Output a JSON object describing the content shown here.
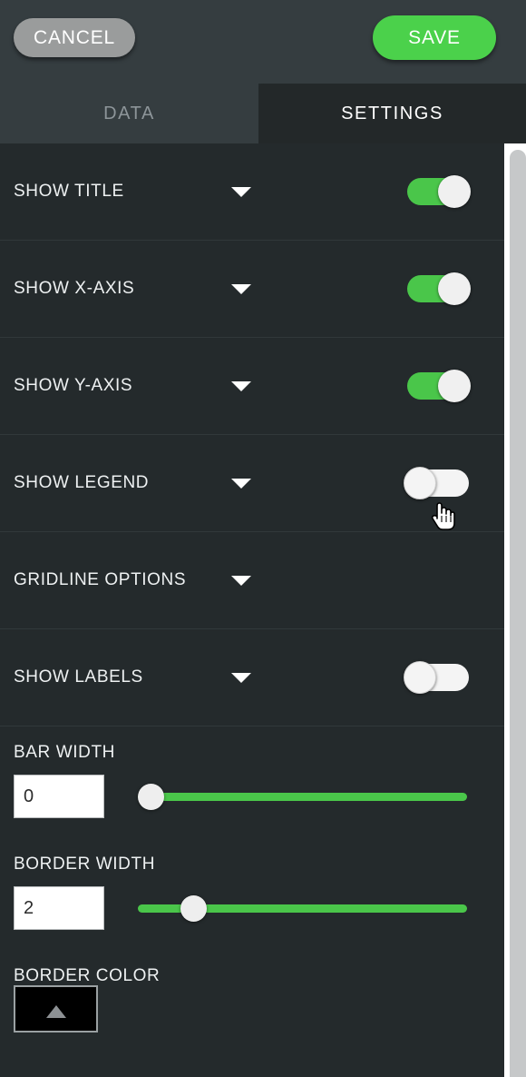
{
  "header": {
    "cancel_label": "CANCEL",
    "save_label": "SAVE",
    "cancel_color": "#9a9c9c",
    "save_color": "#4bd14b"
  },
  "tabs": [
    {
      "label": "DATA",
      "active": false
    },
    {
      "label": "SETTINGS",
      "active": true
    }
  ],
  "settings": {
    "rows": [
      {
        "label": "SHOW TITLE",
        "caret": true,
        "toggle": "on"
      },
      {
        "label": "SHOW X-AXIS",
        "caret": true,
        "toggle": "on"
      },
      {
        "label": "SHOW Y-AXIS",
        "caret": true,
        "toggle": "on"
      },
      {
        "label": "SHOW LEGEND",
        "caret": true,
        "toggle": "off"
      },
      {
        "label": "GRIDLINE OPTIONS",
        "caret": true,
        "toggle": "none"
      },
      {
        "label": "SHOW LABELS",
        "caret": true,
        "toggle": "off"
      }
    ],
    "sliders": [
      {
        "label": "BAR WIDTH",
        "value": "0",
        "fill_percent": 0
      },
      {
        "label": "BORDER WIDTH",
        "value": "2",
        "fill_percent": 14
      }
    ],
    "color": {
      "label": "BORDER COLOR",
      "value": "#000000"
    }
  },
  "theme": {
    "accent_green": "#4ac64a",
    "background": "#242a2c",
    "header_background": "#353d40",
    "active_tab_background": "#232829"
  }
}
